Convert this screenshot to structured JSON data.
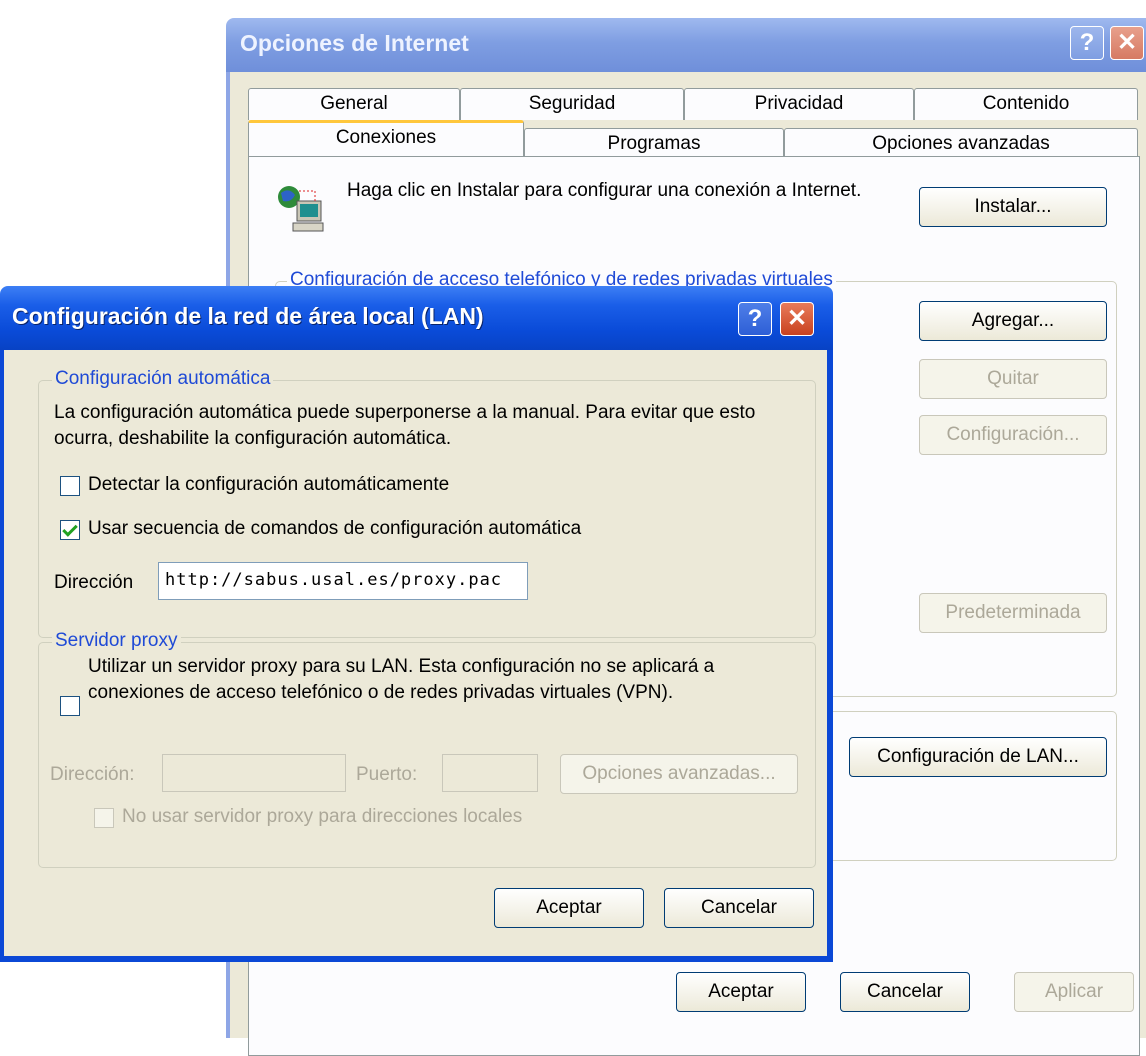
{
  "parent": {
    "title": "Opciones de Internet",
    "tabs_row1": [
      "General",
      "Seguridad",
      "Privacidad",
      "Contenido"
    ],
    "tabs_row2": [
      "Conexiones",
      "Programas",
      "Opciones avanzadas"
    ],
    "install_text": "Haga clic en Instalar para configurar una conexión a Internet.",
    "install_button": "Instalar...",
    "dialup_group_label": "Configuración de acceso telefónico y de redes privadas virtuales",
    "add_button": "Agregar...",
    "remove_button": "Quitar",
    "settings_button": "Configuración...",
    "default_button": "Predeterminada",
    "lan_settings_button": "Configuración de LAN...",
    "ok_button": "Aceptar",
    "cancel_button": "Cancelar",
    "apply_button": "Aplicar"
  },
  "lan": {
    "title": "Configuración de la red de área local (LAN)",
    "help_glyph": "?",
    "close_glyph": "✕",
    "auto_group_label": "Configuración automática",
    "auto_desc": "La configuración automática puede superponerse a la manual. Para evitar que esto ocurra, deshabilite la configuración automática.",
    "detect_auto_label": "Detectar la configuración automáticamente",
    "detect_auto_checked": false,
    "use_script_label": "Usar secuencia de comandos de configuración automática",
    "use_script_checked": true,
    "address_label": "Dirección",
    "address_value": "http://sabus.usal.es/proxy.pac",
    "proxy_group_label": "Servidor proxy",
    "use_proxy_label": "Utilizar un servidor proxy para su LAN. Esta configuración no se aplicará a conexiones de acceso telefónico o de redes privadas virtuales (VPN).",
    "use_proxy_checked": false,
    "proxy_address_label": "Dirección:",
    "proxy_port_label": "Puerto:",
    "advanced_button": "Opciones avanzadas...",
    "bypass_local_label": "No usar servidor proxy para direcciones locales",
    "ok_button": "Aceptar",
    "cancel_button": "Cancelar"
  }
}
